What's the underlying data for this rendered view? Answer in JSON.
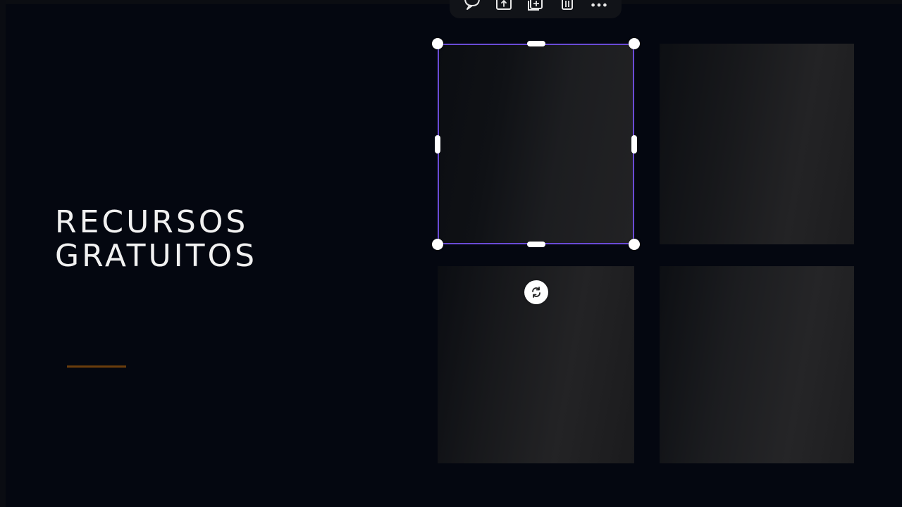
{
  "slide": {
    "title_line1": "RECURSOS",
    "title_line2": "GRATUITOS",
    "accent_color": "#6b3d0c",
    "background_color": "#040710"
  },
  "selection": {
    "border_color": "#6a4bd6"
  },
  "toolbar": {
    "icons": [
      "comment-icon",
      "upload-icon",
      "duplicate-icon",
      "trash-icon",
      "more-icon"
    ]
  },
  "rotate_handle": {
    "icon": "rotate-icon"
  }
}
